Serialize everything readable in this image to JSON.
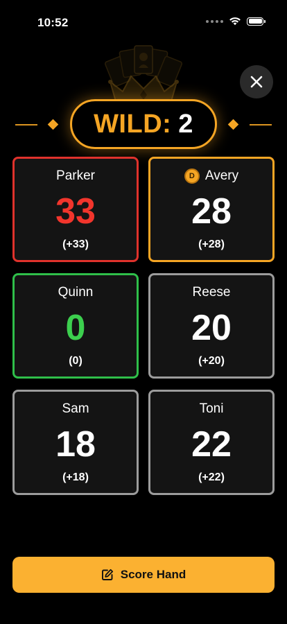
{
  "status_bar": {
    "time": "10:52",
    "icons": [
      "signal-dots-icon",
      "wifi-icon",
      "battery-icon"
    ]
  },
  "header": {
    "art": "crown-cards-icon",
    "close_icon": "close-icon",
    "wild": {
      "label": "WILD:",
      "value": "2"
    }
  },
  "players": [
    {
      "name": "Parker",
      "score": "33",
      "delta": "(+33)",
      "status": "red",
      "dealer": false
    },
    {
      "name": "Avery",
      "score": "28",
      "delta": "(+28)",
      "status": "gold",
      "dealer": true,
      "dealer_badge": "D"
    },
    {
      "name": "Quinn",
      "score": "0",
      "delta": "(0)",
      "status": "green",
      "dealer": false
    },
    {
      "name": "Reese",
      "score": "20",
      "delta": "(+20)",
      "status": "gray",
      "dealer": false
    },
    {
      "name": "Sam",
      "score": "18",
      "delta": "(+18)",
      "status": "gray",
      "dealer": false
    },
    {
      "name": "Toni",
      "score": "22",
      "delta": "(+22)",
      "status": "gray",
      "dealer": false
    }
  ],
  "footer": {
    "score_hand_label": "Score Hand",
    "score_hand_icon": "edit-icon"
  },
  "colors": {
    "accent": "#F5A524",
    "button": "#FBB131",
    "leader_red": "#E0322C",
    "lowest_green": "#2FBF4A",
    "neutral_border": "#9C9C9C",
    "card_bg": "#141414",
    "background": "#000000"
  }
}
